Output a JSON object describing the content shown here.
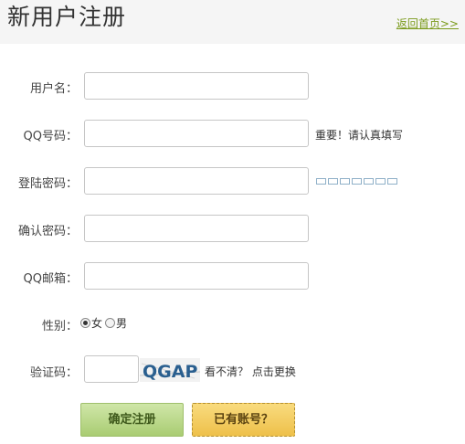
{
  "header": {
    "title": "新用户注册",
    "back_link": "返回首页>>"
  },
  "form": {
    "username": {
      "label": "用户名：",
      "value": ""
    },
    "qq": {
      "label": "QQ号码：",
      "value": "",
      "hint": "重要！请认真填写"
    },
    "password": {
      "label": "登陆密码：",
      "value": "",
      "strength_segments": 7
    },
    "confirm_password": {
      "label": "确认密码：",
      "value": ""
    },
    "qq_email": {
      "label": "QQ邮箱：",
      "value": ""
    },
    "gender": {
      "label": "性别：",
      "options": [
        "女",
        "男"
      ],
      "selected": "女"
    },
    "captcha": {
      "label": "验证码：",
      "value": "",
      "image_text": "QGAP",
      "refresh_text": "看不清？ 点击更换"
    }
  },
  "buttons": {
    "submit": "确定注册",
    "has_account": "已有账号？"
  },
  "colors": {
    "link": "#7a9a1a",
    "submit_bg": "#b4d382",
    "account_bg": "#f2c95a"
  }
}
